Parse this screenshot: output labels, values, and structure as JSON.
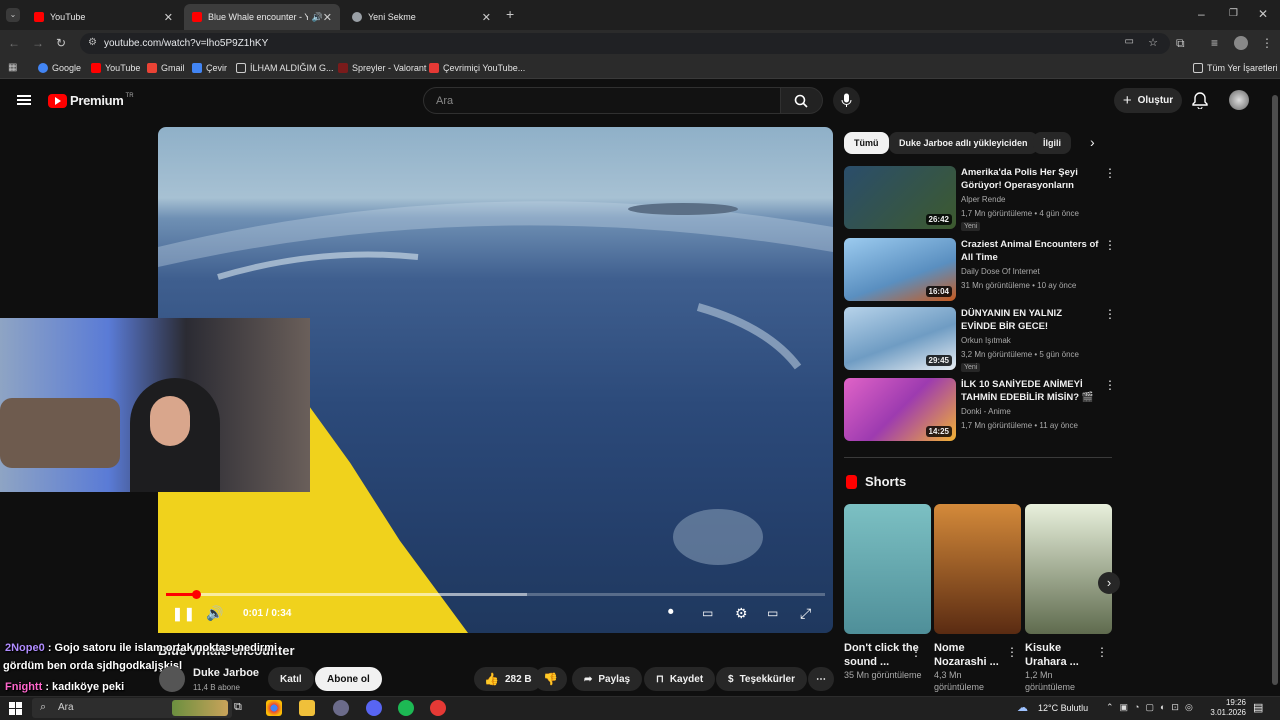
{
  "browser": {
    "tabs": [
      {
        "title": "YouTube",
        "active": false
      },
      {
        "title": "Blue Whale encounter - You",
        "active": true
      },
      {
        "title": "Yeni Sekme",
        "active": false
      }
    ],
    "url": "youtube.com/watch?v=lho5P9Z1hKY",
    "bookmarks": [
      "Google",
      "YouTube",
      "Gmail",
      "Çevir",
      "İLHAM ALDIĞIM G...",
      "Spreyler - Valorant",
      "Çevrimiçi YouTube..."
    ],
    "all_bookmarks": "Tüm Yer İşaretleri"
  },
  "header": {
    "logo": "Premium",
    "region": "TR",
    "search_placeholder": "Ara",
    "create_label": "Oluştur"
  },
  "video": {
    "title": "Blue Whale encounter",
    "time_current": "0:01",
    "time_total": "0:34",
    "progress": 0.03,
    "buffered": 0.55,
    "channel": "Duke Jarboe",
    "subscribers": "11,4 B abone",
    "join_label": "Katıl",
    "subscribe_label": "Abone ol",
    "likes": "282 B",
    "share_label": "Paylaş",
    "save_label": "Kaydet",
    "thanks_label": "Teşekkürler"
  },
  "chat": [
    {
      "user": "2Nope0",
      "text": ": Gojo satoru ile islam ortak noktası nedirmi"
    },
    {
      "user": "",
      "text": "gördüm ben orda sjdhgodkaljşkişl"
    },
    {
      "user": "Fnightt",
      "text": ": kadıköye peki"
    }
  ],
  "filters": [
    "Tümü",
    "Duke Jarboe adlı yükleyiciden",
    "İlgili"
  ],
  "recommendations": [
    {
      "title": "Amerika'da Polis Her Şeyi Görüyor! Operasyonların Perde...",
      "channel": "Alper Rende",
      "meta": "1,7 Mn görüntüleme • 4 gün önce",
      "badge": "Yeni",
      "duration": "26:42",
      "thumb_color": "#3d5a2e"
    },
    {
      "title": "Craziest Animal Encounters of All Time",
      "channel": "Daily Dose Of Internet",
      "meta": "31 Mn görüntüleme • 10 ay önce",
      "badge": "",
      "duration": "16:04",
      "thumb_color": "#7db2dc"
    },
    {
      "title": "DÜNYANIN EN YALNIZ EVİNDE BİR GECE!",
      "channel": "Orkun Işıtmak",
      "meta": "3,2 Mn görüntüleme • 5 gün önce",
      "badge": "Yeni",
      "duration": "29:45",
      "thumb_color": "#8fb6d6"
    },
    {
      "title": "İLK 10 SANİYEDE ANİMEYİ TAHMİN EDEBİLİR MİSİN? 🎬 ...",
      "channel": "Donki - Anime",
      "meta": "1,7 Mn görüntüleme • 11 ay önce",
      "badge": "",
      "duration": "14:25",
      "thumb_color": "#c44db8"
    }
  ],
  "shorts_header": "Shorts",
  "shorts": [
    {
      "title": "Don't click the sound ...",
      "meta": "35 Mn görüntüleme",
      "color": "#6fa9a6"
    },
    {
      "title": "Nome Nozarashi ...",
      "meta": "4,3 Mn görüntüleme",
      "color": "#b06a2a"
    },
    {
      "title": "Kisuke Urahara ...",
      "meta": "1,2 Mn görüntüleme",
      "color": "#d9e4d0"
    }
  ],
  "taskbar": {
    "search": "Ara",
    "weather": "12°C  Bulutlu",
    "time": "19:26",
    "date": "3.01.2026"
  }
}
